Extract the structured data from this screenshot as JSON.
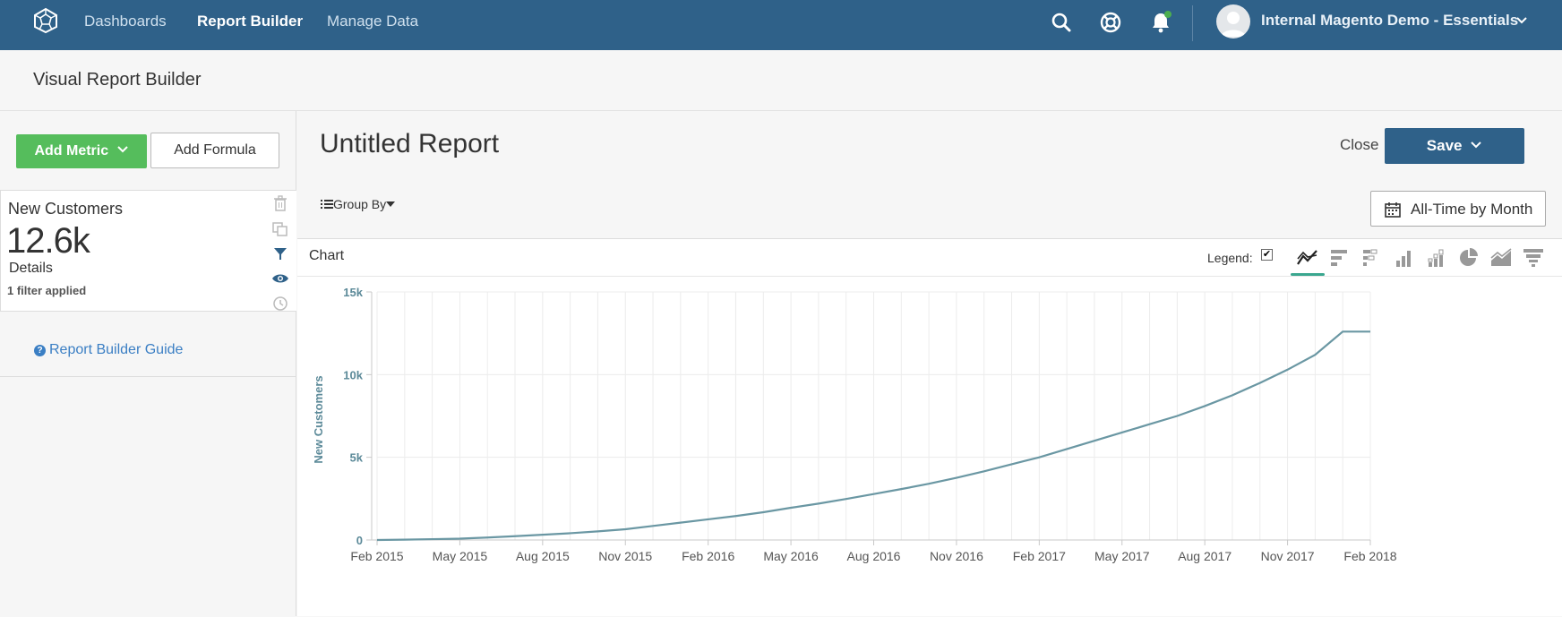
{
  "topnav": {
    "links": [
      {
        "label": "Dashboards",
        "active": false
      },
      {
        "label": "Report Builder",
        "active": true
      },
      {
        "label": "Manage Data",
        "active": false
      }
    ],
    "account": "Internal Magento Demo - Essentials",
    "notification_dot_color": "#4caf50"
  },
  "subheader": {
    "title": "Visual Report Builder"
  },
  "sidebar": {
    "add_metric_label": "Add Metric",
    "add_formula_label": "Add Formula",
    "metric": {
      "name": "New Customers",
      "value": "12.6k",
      "details_label": "Details",
      "filter_text": "1 filter applied"
    },
    "guide_label": "Report Builder Guide"
  },
  "main": {
    "report_title": "Untitled Report",
    "close_label": "Close",
    "save_label": "Save",
    "group_by_label": "Group By",
    "date_range_label": "All-Time by Month",
    "chart_panel_label": "Chart",
    "legend_label": "Legend:",
    "legend_checked": true,
    "chart_types": [
      "line",
      "bar-horizontal",
      "bar-horizontal-stacked",
      "column",
      "column-stacked",
      "pie",
      "area",
      "funnel"
    ],
    "active_chart_type": "line"
  },
  "chart_data": {
    "type": "line",
    "title": "",
    "xlabel": "",
    "ylabel": "New Customers",
    "ylim": [
      0,
      15000
    ],
    "y_ticks": [
      "0",
      "5k",
      "10k",
      "15k"
    ],
    "x_tick_labels": [
      "Feb 2015",
      "May 2015",
      "Aug 2015",
      "Nov 2015",
      "Feb 2016",
      "May 2016",
      "Aug 2016",
      "Nov 2016",
      "Feb 2017",
      "May 2017",
      "Aug 2017",
      "Nov 2017",
      "Feb 2018"
    ],
    "grid": true,
    "series": [
      {
        "color": "#6a97a3",
        "x": [
          "2015-02",
          "2015-03",
          "2015-04",
          "2015-05",
          "2015-06",
          "2015-07",
          "2015-08",
          "2015-09",
          "2015-10",
          "2015-11",
          "2015-12",
          "2016-01",
          "2016-02",
          "2016-03",
          "2016-04",
          "2016-05",
          "2016-06",
          "2016-07",
          "2016-08",
          "2016-09",
          "2016-10",
          "2016-11",
          "2016-12",
          "2017-01",
          "2017-02",
          "2017-03",
          "2017-04",
          "2017-05",
          "2017-06",
          "2017-07",
          "2017-08",
          "2017-09",
          "2017-10",
          "2017-11",
          "2017-12",
          "2018-01",
          "2018-02"
        ],
        "values": [
          0,
          20,
          50,
          80,
          150,
          230,
          320,
          410,
          520,
          650,
          850,
          1050,
          1250,
          1450,
          1680,
          1950,
          2200,
          2480,
          2780,
          3080,
          3400,
          3760,
          4150,
          4580,
          5000,
          5500,
          6000,
          6500,
          7000,
          7500,
          8100,
          8750,
          9500,
          10300,
          11200,
          12600,
          12600
        ]
      }
    ]
  }
}
